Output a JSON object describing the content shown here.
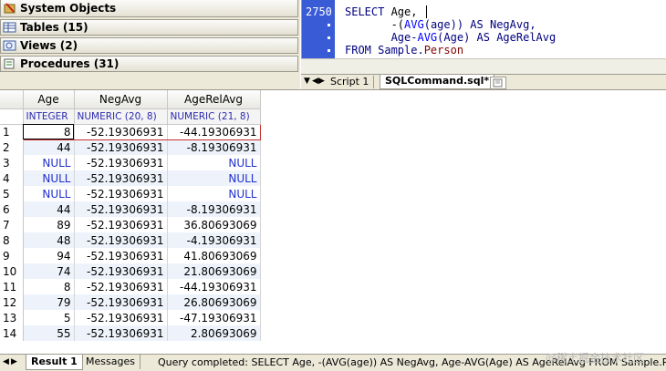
{
  "tree": {
    "items": [
      {
        "label": "System Objects",
        "icon": "gear-icon"
      },
      {
        "label": "Tables (15)",
        "icon": "table-icon"
      },
      {
        "label": "Views (2)",
        "icon": "view-icon"
      },
      {
        "label": "Procedures (31)",
        "icon": "procedure-icon"
      }
    ]
  },
  "editor": {
    "line_number": "2750",
    "lines": [
      {
        "kw1": "SELECT",
        "rest": " Age,"
      },
      {
        "pre": "       -(",
        "fn": "AVG",
        "mid": "(age)) AS NegAvg,"
      },
      {
        "pre": "       Age-",
        "fn": "AVG",
        "mid": "(Age) AS AgeRelAvg"
      },
      {
        "kw1": "FROM",
        "rest": " Sample.",
        "obj": "Person"
      }
    ],
    "tabs": {
      "script": "Script 1",
      "sql": "SQLCommand.sql*"
    }
  },
  "grid": {
    "columns": [
      "Age",
      "NegAvg",
      "AgeRelAvg"
    ],
    "types": [
      "INTEGER",
      "NUMERIC (20, 8)",
      "NUMERIC (21, 8)"
    ],
    "rows": [
      [
        "1",
        "8",
        "-52.19306931",
        "-44.19306931"
      ],
      [
        "2",
        "44",
        "-52.19306931",
        "-8.19306931"
      ],
      [
        "3",
        "NULL",
        "-52.19306931",
        "NULL"
      ],
      [
        "4",
        "NULL",
        "-52.19306931",
        "NULL"
      ],
      [
        "5",
        "NULL",
        "-52.19306931",
        "NULL"
      ],
      [
        "6",
        "44",
        "-52.19306931",
        "-8.19306931"
      ],
      [
        "7",
        "89",
        "-52.19306931",
        "36.80693069"
      ],
      [
        "8",
        "48",
        "-52.19306931",
        "-4.19306931"
      ],
      [
        "9",
        "94",
        "-52.19306931",
        "41.80693069"
      ],
      [
        "10",
        "74",
        "-52.19306931",
        "21.80693069"
      ],
      [
        "11",
        "8",
        "-52.19306931",
        "-44.19306931"
      ],
      [
        "12",
        "79",
        "-52.19306931",
        "26.80693069"
      ],
      [
        "13",
        "5",
        "-52.19306931",
        "-47.19306931"
      ],
      [
        "14",
        "55",
        "-52.19306931",
        "2.80693069"
      ]
    ]
  },
  "bottom": {
    "result_tab": "Result 1",
    "messages_tab": "Messages",
    "status": "Query completed: SELECT Age,      -(AVG(age)) AS NegAvg,      Age-AVG(Age) AS AgeRelAvg  FROM Sample.Per"
  },
  "watermark": "@稀土掘金技术社区"
}
